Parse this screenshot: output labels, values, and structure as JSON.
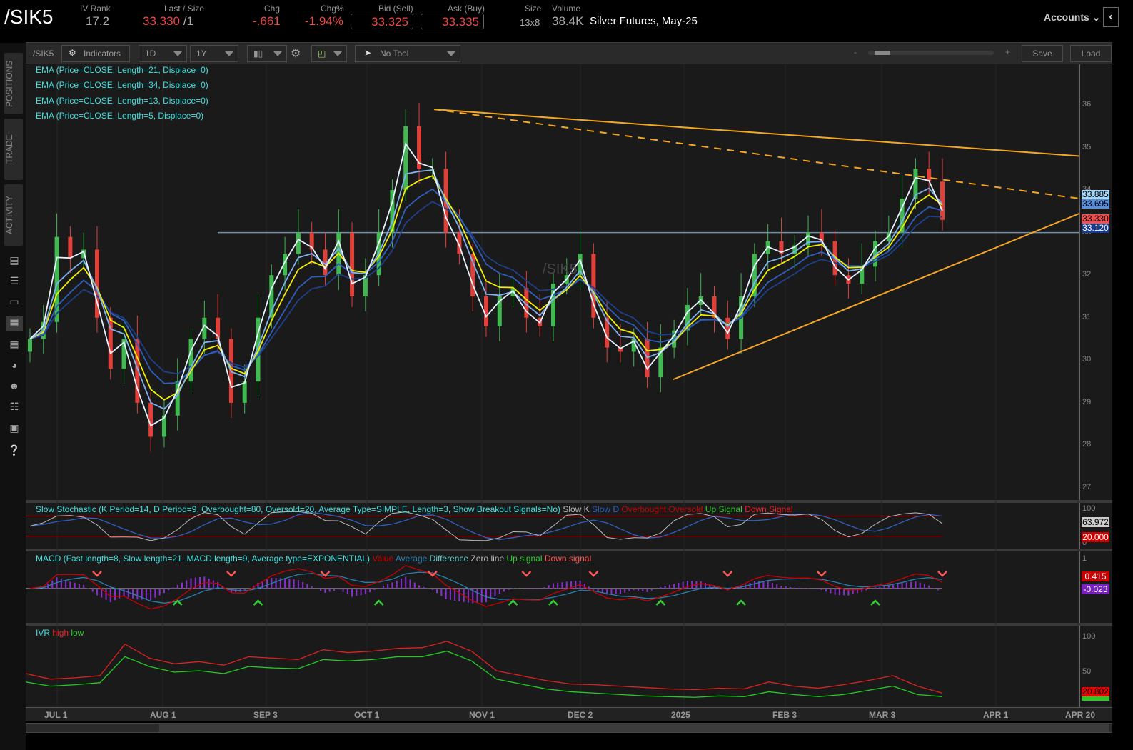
{
  "header": {
    "symbol": "/SIK5",
    "iv_rank_label": "IV Rank",
    "iv_rank": "17.2",
    "last_label": "Last / Size",
    "last": "33.330",
    "last_size": "/1",
    "chg_label": "Chg",
    "chg": "-.661",
    "chgpct_label": "Chg%",
    "chgpct": "-1.94%",
    "bid_label": "Bid (Sell)",
    "bid": "33.325",
    "ask_label": "Ask (Buy)",
    "ask": "33.335",
    "size_label": "Size",
    "size": "13x8",
    "volume_label": "Volume",
    "volume": "38.4K",
    "description": "Silver Futures, May-25",
    "accounts": "Accounts"
  },
  "toolbar": {
    "symbol": "/SIK5",
    "indicators": "Indicators",
    "aggregation": "1D",
    "range": "1Y",
    "tool": "No Tool",
    "zoom_minus": "-",
    "zoom_plus": "+",
    "save": "Save",
    "load": "Load"
  },
  "sidebar": {
    "tabs": [
      "POSITIONS",
      "TRADE",
      "ACTIVITY"
    ]
  },
  "colors": {
    "up": "#3fb950",
    "down": "#e0403a",
    "ema21": "#2f5fbf",
    "ema34": "#1e3f8a",
    "ema13": "#7fb2f0",
    "ema5": "#e8f4ff",
    "yellow": "#f0f000",
    "trend": "#f5a623"
  },
  "chart_data": [
    {
      "type": "candlestick",
      "title": "/SIK5",
      "legend": [
        "EMA (Price=CLOSE, Length=21, Displace=0)",
        "EMA (Price=CLOSE, Length=34, Displace=0)",
        "EMA (Price=CLOSE, Length=13, Displace=0)",
        "EMA (Price=CLOSE, Length=5, Displace=0)"
      ],
      "watermark": "/SIK5",
      "ylim": [
        27,
        36
      ],
      "yticks": [
        "27",
        "28",
        "29",
        "30",
        "31",
        "32",
        "33",
        "34",
        "35",
        "36"
      ],
      "xticks": [
        "JUL 1",
        "AUG 1",
        "SEP 3",
        "OCT 1",
        "NOV 1",
        "DEC 2",
        "2025",
        "FEB 3",
        "MAR 3",
        "APR 1",
        "APR 20"
      ],
      "closes": [
        30.5,
        30.9,
        32.9,
        32.4,
        32.6,
        31.0,
        29.8,
        30.5,
        29.0,
        28.2,
        28.7,
        29.5,
        30.5,
        31.0,
        30.5,
        29.0,
        29.5,
        31.0,
        32.0,
        32.5,
        33.0,
        32.6,
        32.0,
        33.0,
        31.5,
        32.0,
        33.0,
        34.0,
        35.5,
        34.5,
        34.5,
        33.0,
        32.5,
        31.5,
        30.8,
        31.5,
        31.7,
        31.0,
        30.8,
        31.8,
        32.0,
        32.5,
        31.0,
        30.3,
        30.2,
        30.5,
        29.6,
        30.3,
        30.7,
        31.3,
        31.5,
        31.0,
        30.5,
        31.5,
        32.5,
        32.8,
        32.5,
        32.7,
        33.0,
        32.8,
        32.0,
        31.8,
        32.2,
        32.8,
        33.0,
        33.8,
        34.5,
        34.2,
        33.3
      ],
      "horizontal_level": 33.0,
      "trendlines": [
        {
          "name": "resistance",
          "from": [
            "OCT 22",
            35.9
          ],
          "to": [
            "APR 20",
            34.8
          ],
          "style": "solid"
        },
        {
          "name": "resistance-dashed",
          "from": [
            "OCT 22",
            35.9
          ],
          "to": [
            "APR 20",
            33.8
          ],
          "style": "dashed"
        },
        {
          "name": "support",
          "from": [
            "DEC 31",
            29.55
          ],
          "to": [
            "APR 20",
            33.45
          ],
          "style": "solid"
        }
      ],
      "price_tags": [
        {
          "value": "33.885",
          "bg": "#a8d8f8",
          "fg": "#000"
        },
        {
          "value": "33.695",
          "bg": "#5a8fe0",
          "fg": "#000"
        },
        {
          "value": "33.330",
          "bg": "#f05050",
          "fg": "#000"
        },
        {
          "value": "33.120",
          "bg": "#1a3a8a",
          "fg": "#fff"
        }
      ]
    },
    {
      "type": "line",
      "title": "Slow Stochastic (K Period=14, D Period=9, Overbought=80, Oversold=20, Average Type=SIMPLE, Length=3, Show Breakout Signals=No)",
      "legend": [
        {
          "label": "Slow K",
          "color": "#bbb"
        },
        {
          "label": "Slow D",
          "color": "#2f5fbf"
        },
        {
          "label": "Overbought",
          "color": "#c00"
        },
        {
          "label": "Oversold",
          "color": "#c00"
        },
        {
          "label": "Up Signal",
          "color": "#3c3"
        },
        {
          "label": "Down Signal",
          "color": "#e22"
        }
      ],
      "ylim": [
        0,
        100
      ],
      "yticks": [
        "100",
        "0"
      ],
      "overbought": 80,
      "oversold": 20,
      "tags": [
        {
          "value": "63.972",
          "bg": "#ccc",
          "fg": "#000"
        },
        {
          "value": "20.000",
          "bg": "#c00",
          "fg": "#fff"
        }
      ]
    },
    {
      "type": "line",
      "title": "MACD (Fast length=8, Slow length=21, MACD length=9, Average type=EXPONENTIAL)",
      "legend": [
        {
          "label": "Value",
          "color": "#c00"
        },
        {
          "label": "Average",
          "color": "#2a7fb0"
        },
        {
          "label": "Difference",
          "color": "#6cc"
        },
        {
          "label": "Zero line",
          "color": "#bbb"
        },
        {
          "label": "Up signal",
          "color": "#3c3"
        },
        {
          "label": "Down signal",
          "color": "#f55"
        }
      ],
      "yticks": [
        "1"
      ],
      "tags": [
        {
          "value": "0.415",
          "bg": "#c00",
          "fg": "#fff"
        },
        {
          "value": "-0.023",
          "bg": "#7a1fc0",
          "fg": "#fff"
        }
      ]
    },
    {
      "type": "line",
      "title": "IVR",
      "legend": [
        {
          "label": "high",
          "color": "#e22"
        },
        {
          "label": "low",
          "color": "#3c3"
        }
      ],
      "ylim": [
        0,
        100
      ],
      "yticks": [
        "100",
        "50"
      ],
      "high": [
        48,
        40,
        42,
        45,
        90,
        70,
        62,
        65,
        60,
        72,
        70,
        68,
        82,
        78,
        80,
        84,
        85,
        94,
        80,
        52,
        45,
        38,
        33,
        32,
        30,
        28,
        26,
        25,
        27,
        26,
        36,
        30,
        27,
        32,
        38,
        45,
        30,
        20
      ],
      "low": [
        36,
        30,
        32,
        35,
        72,
        58,
        50,
        52,
        48,
        58,
        56,
        55,
        68,
        66,
        68,
        72,
        72,
        80,
        66,
        40,
        33,
        26,
        22,
        20,
        18,
        16,
        15,
        14,
        16,
        15,
        22,
        18,
        15,
        18,
        24,
        30,
        18,
        15
      ],
      "tags": [
        {
          "value": "20.802",
          "bg": "#e00",
          "fg": "#000"
        }
      ]
    }
  ]
}
